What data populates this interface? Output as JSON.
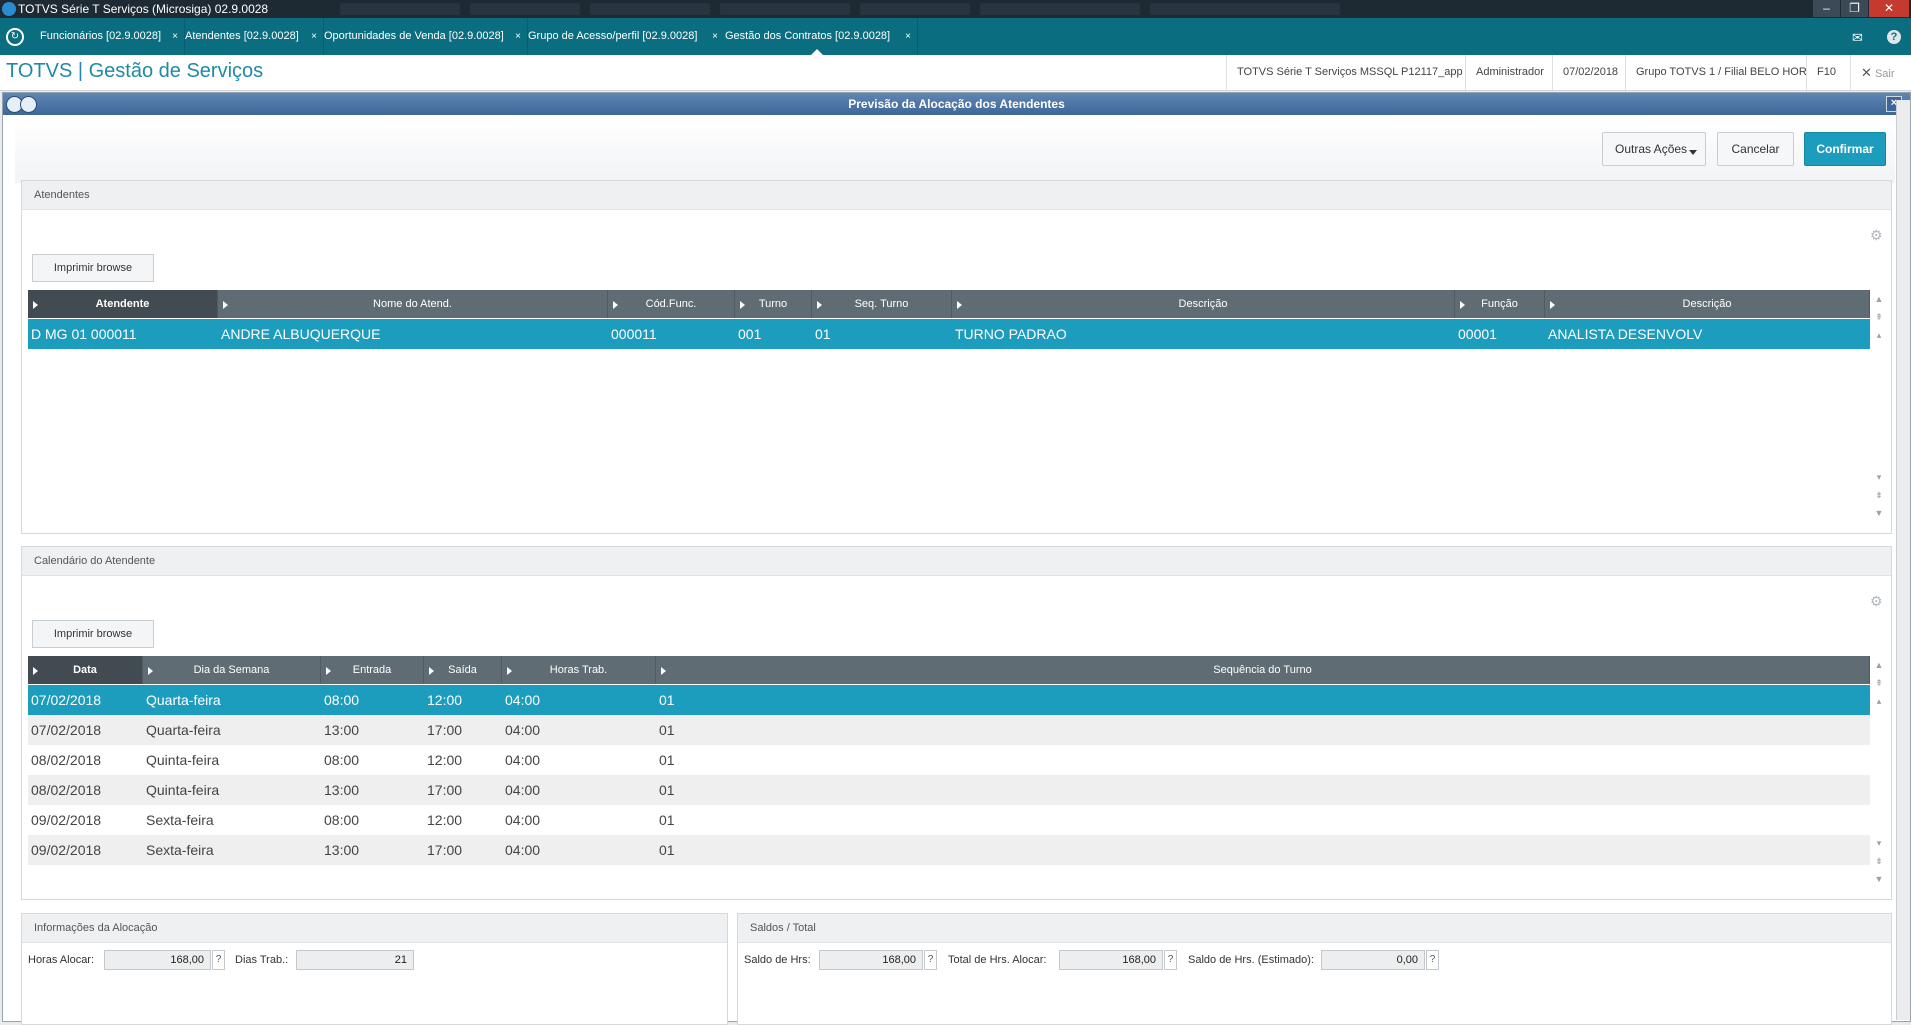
{
  "window": {
    "title": "TOTVS Série T Serviços (Microsiga) 02.9.0028",
    "controls": [
      "‒",
      "❐",
      "✕"
    ]
  },
  "tabs": [
    {
      "label": "Funcionários [02.9.0028]"
    },
    {
      "label": "Atendentes [02.9.0028]"
    },
    {
      "label": "Oportunidades de Venda [02.9.0028]"
    },
    {
      "label": "Grupo de Acesso/perfil [02.9.0028]"
    },
    {
      "label": "Gestão dos Contratos [02.9.0028]"
    }
  ],
  "tab_close": "×",
  "header": {
    "brand": "TOTVS | Gestão de Serviços",
    "environment": "TOTVS Série T Serviços MSSQL P12117_app",
    "user": "Administrador",
    "date": "07/02/2018",
    "branch": "Grupo TOTVS 1 / Filial BELO HOR",
    "f10": "F10",
    "exit": "Sair"
  },
  "dialog": {
    "title": "Previsão da Alocação dos Atendentes",
    "actions": {
      "other": "Outras Ações",
      "cancel": "Cancelar",
      "confirm": "Confirmar"
    }
  },
  "attendants": {
    "title": "Atendentes",
    "print_label": "Imprimir browse",
    "columns": [
      "Atendente",
      "Nome do Atend.",
      "Cód.Func.",
      "Turno",
      "Seq. Turno",
      "Descrição",
      "Função",
      "Descrição"
    ],
    "rows": [
      [
        "D MG 01 000011",
        "ANDRE ALBUQUERQUE",
        "000011",
        "001",
        "01",
        "TURNO PADRAO",
        "00001",
        "ANALISTA DESENVOLV"
      ]
    ]
  },
  "calendar": {
    "title": "Calendário do Atendente",
    "print_label": "Imprimir browse",
    "columns": [
      "Data",
      "Dia da Semana",
      "Entrada",
      "Saída",
      "Horas Trab.",
      "Sequência do Turno"
    ],
    "rows": [
      [
        "07/02/2018",
        "Quarta-feira",
        "08:00",
        "12:00",
        "04:00",
        "01"
      ],
      [
        "07/02/2018",
        "Quarta-feira",
        "13:00",
        "17:00",
        "04:00",
        "01"
      ],
      [
        "08/02/2018",
        "Quinta-feira",
        "08:00",
        "12:00",
        "04:00",
        "01"
      ],
      [
        "08/02/2018",
        "Quinta-feira",
        "13:00",
        "17:00",
        "04:00",
        "01"
      ],
      [
        "09/02/2018",
        "Sexta-feira",
        "08:00",
        "12:00",
        "04:00",
        "01"
      ],
      [
        "09/02/2018",
        "Sexta-feira",
        "13:00",
        "17:00",
        "04:00",
        "01"
      ]
    ]
  },
  "allocation_info": {
    "title": "Informações da Alocação",
    "hours_label": "Horas Alocar:",
    "hours_value": "168,00",
    "days_label": "Dias Trab.:",
    "days_value": "21"
  },
  "totals": {
    "title": "Saldos / Total",
    "balance_label": "Saldo de Hrs:",
    "balance_value": "168,00",
    "total_label": "Total de Hrs. Alocar:",
    "total_value": "168,00",
    "estimated_label": "Saldo de Hrs. (Estimado):",
    "estimated_value": "0,00"
  },
  "help_mark": "?",
  "colors": {
    "accent": "#1d9dbd",
    "tabbar": "#0b6d80",
    "grid_header": "#606c74",
    "dialog_title": "#4a73a5"
  }
}
